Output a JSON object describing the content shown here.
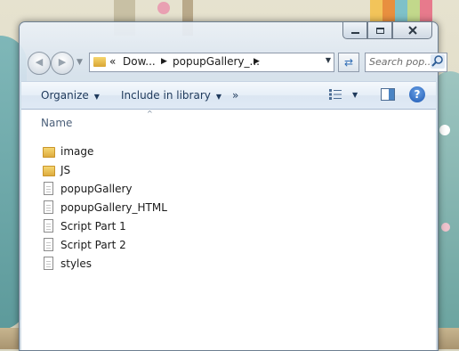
{
  "window": {
    "caption_buttons": [
      "minimize",
      "maximize",
      "close"
    ]
  },
  "address_bar": {
    "crumbs": [
      "«",
      "Dow...",
      "popupGallery_..."
    ],
    "search_placeholder": "Search pop..."
  },
  "command_bar": {
    "organize": "Organize",
    "include_in_library": "Include in library",
    "more": "»"
  },
  "column_header": {
    "name": "Name"
  },
  "files": [
    {
      "name": "image",
      "type": "folder"
    },
    {
      "name": "JS",
      "type": "folder"
    },
    {
      "name": "popupGallery",
      "type": "file"
    },
    {
      "name": "popupGallery_HTML",
      "type": "file"
    },
    {
      "name": "Script Part 1",
      "type": "file"
    },
    {
      "name": "Script Part 2",
      "type": "file"
    },
    {
      "name": "styles",
      "type": "file"
    }
  ]
}
